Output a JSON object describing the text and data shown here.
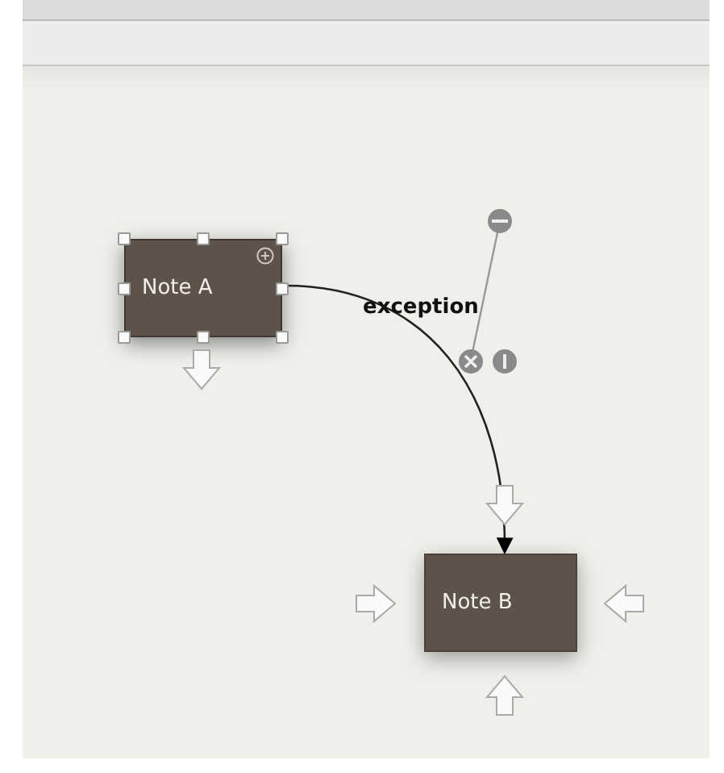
{
  "notes": [
    {
      "label": "Note A",
      "selected": true
    },
    {
      "label": "Note B",
      "selected": false
    }
  ],
  "connection": {
    "label": "exception"
  }
}
